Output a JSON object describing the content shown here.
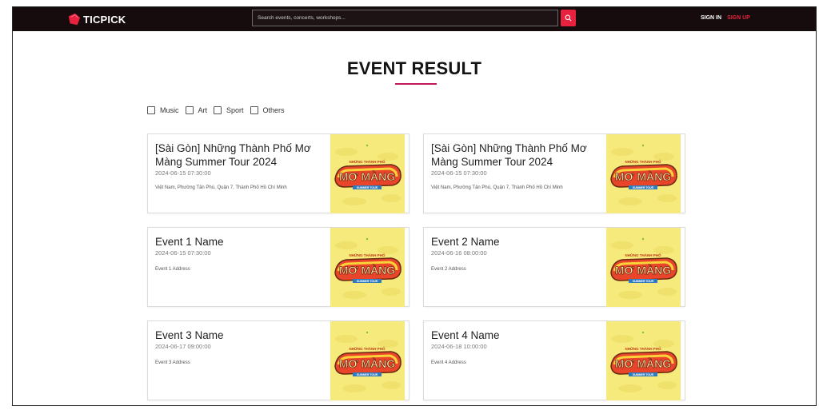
{
  "brand": {
    "name": "TICPICK",
    "accent": "#e8213f"
  },
  "header": {
    "search_placeholder": "Search events, concerts, workshops...",
    "search_icon": "search-icon",
    "sign_in": "SIGN IN",
    "sign_up": "SIGN UP"
  },
  "page": {
    "title": "EVENT RESULT"
  },
  "filters": [
    {
      "label": "Music",
      "checked": false
    },
    {
      "label": "Art",
      "checked": false
    },
    {
      "label": "Sport",
      "checked": false
    },
    {
      "label": "Others",
      "checked": false
    }
  ],
  "events": [
    {
      "title": "[Sài Gòn] Những Thành Phố Mơ Màng Summer Tour 2024",
      "date": "2024-06-15 07:30:00",
      "address": "Việt Nam, Phường Tân Phú, Quận 7, Thành Phố Hồ Chí Minh",
      "thumb_text": "NHỮNG THÀNH PHỐ MƠ MÀNG SUMMER TOUR"
    },
    {
      "title": "[Sài Gòn] Những Thành Phố Mơ Màng Summer Tour 2024",
      "date": "2024-06-15 07:30:00",
      "address": "Việt Nam, Phường Tân Phú, Quận 7, Thành Phố Hồ Chí Minh",
      "thumb_text": "NHỮNG THÀNH PHỐ MƠ MÀNG SUMMER TOUR"
    },
    {
      "title": "Event 1 Name",
      "date": "2024-06-15 07:30:00",
      "address": "Event 1 Address",
      "thumb_text": "NHỮNG THÀNH PHỐ MƠ MÀNG SUMMER TOUR"
    },
    {
      "title": "Event 2 Name",
      "date": "2024-06-16 08:00:00",
      "address": "Event 2 Address",
      "thumb_text": "NHỮNG THÀNH PHỐ MƠ MÀNG SUMMER TOUR"
    },
    {
      "title": "Event 3 Name",
      "date": "2024-06-17 09:00:00",
      "address": "Event 3 Address",
      "thumb_text": "NHỮNG THÀNH PHỐ MƠ MÀNG SUMMER TOUR"
    },
    {
      "title": "Event 4 Name",
      "date": "2024-06-18 10:00:00",
      "address": "Event 4 Address",
      "thumb_text": "NHỮNG THÀNH PHỐ MƠ MÀNG SUMMER TOUR"
    }
  ]
}
